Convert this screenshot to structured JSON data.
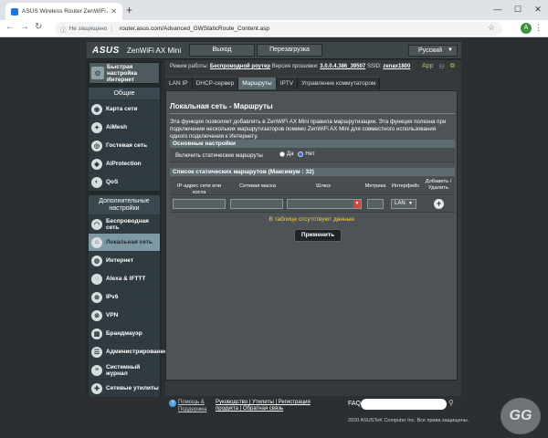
{
  "browser": {
    "tab_title": "ASUS Wireless Router ZenWiFi A",
    "not_secure": "Не защищено",
    "url": "router.asus.com/Advanced_GWStaticRoute_Content.asp",
    "avatar": "A"
  },
  "header": {
    "logo": "ASUS",
    "model": "ZenWiFi AX Mini",
    "logout": "Выход",
    "reboot": "Перезагрузка",
    "language": "Русский"
  },
  "status": {
    "mode_label": "Режим работы:",
    "mode_value": "Беспроводной роутер",
    "fw_label": "Версия прошивки:",
    "fw_value": "3.0.0.4.386_39507",
    "ssid_label": "SSID:",
    "ssid_value": "zenax1800",
    "app": "App"
  },
  "sidebar": {
    "quick_setup": "Быстрая настройка Интернет",
    "general_title": "Общие",
    "general": [
      {
        "label": "Карта сети",
        "icon": "network-map-icon"
      },
      {
        "label": "AiMesh",
        "icon": "aimesh-icon"
      },
      {
        "label": "Гостевая сеть",
        "icon": "guest-network-icon"
      },
      {
        "label": "AiProtection",
        "icon": "aiprotection-icon"
      },
      {
        "label": "QoS",
        "icon": "qos-icon"
      }
    ],
    "advanced_title": "Дополнительные настройки",
    "advanced": [
      {
        "label": "Беспроводная сеть",
        "icon": "wireless-icon"
      },
      {
        "label": "Локальная сеть",
        "icon": "lan-icon"
      },
      {
        "label": "Интернет",
        "icon": "internet-icon"
      },
      {
        "label": "Alexa & IFTTT",
        "icon": "alexa-icon"
      },
      {
        "label": "IPv6",
        "icon": "ipv6-icon"
      },
      {
        "label": "VPN",
        "icon": "vpn-icon"
      },
      {
        "label": "Брандмауэр",
        "icon": "firewall-icon"
      },
      {
        "label": "Администрирование",
        "icon": "admin-icon"
      },
      {
        "label": "Системный журнал",
        "icon": "syslog-icon"
      },
      {
        "label": "Сетевые утилиты",
        "icon": "tools-icon"
      }
    ]
  },
  "tabs": [
    "LAN IP",
    "DHCP-сервер",
    "Маршруты",
    "IPTV",
    "Управление коммутатором"
  ],
  "content": {
    "title": "Локальная сеть - Маршруты",
    "description": "Эта функция позволяет добавлять в ZenWiFi AX Mini правила маршрутизации. Эта функция полезна при подключении нескольких маршрутизаторов помимо ZenWiFi AX Mini для совместного использования одного подключения к Интернету.",
    "basic_header": "Основные настройки",
    "enable_label": "Включить статические маршруты",
    "yes": "Да",
    "no": "Нет",
    "list_header": "Список статических маршрутов (Максимум : 32)",
    "columns": [
      "IP-адрес сети или хоста",
      "Сетевая маска",
      "Шлюз",
      "Метрика",
      "Интерфейс",
      "Добавить / Удалить"
    ],
    "iface_value": "LAN",
    "empty": "В таблице отсутствуют данные.",
    "apply": "Применить"
  },
  "footer": {
    "help": "Помощь &",
    "help2": "Поддержка",
    "links1": "Руководство | Утилиты | Регистрация",
    "links2": "продукта | Обратная связь",
    "faq": "FAQ",
    "copyright": "2020 ASUSTeK Computer Inc. Все права защищены."
  },
  "watermark": "GG"
}
